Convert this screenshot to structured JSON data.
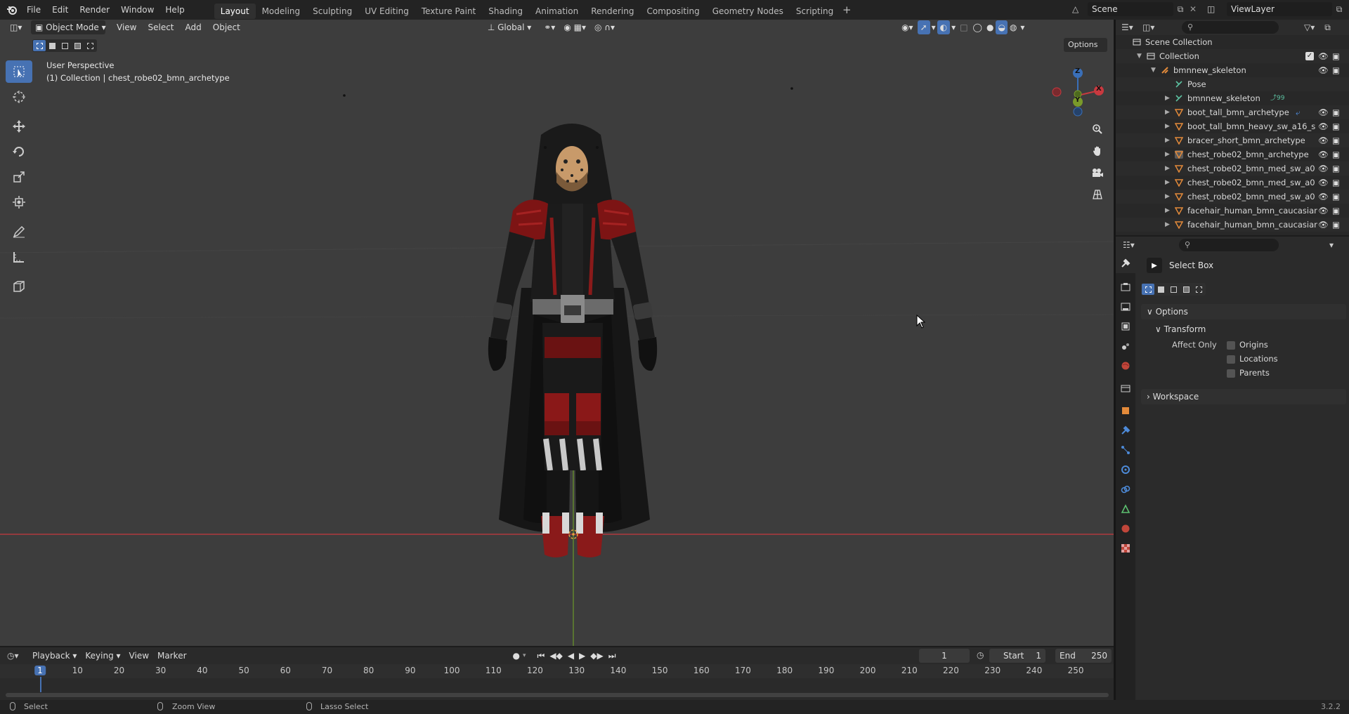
{
  "menu": {
    "file": "File",
    "edit": "Edit",
    "render": "Render",
    "window": "Window",
    "help": "Help"
  },
  "workspaces": [
    "Layout",
    "Modeling",
    "Sculpting",
    "UV Editing",
    "Texture Paint",
    "Shading",
    "Animation",
    "Rendering",
    "Compositing",
    "Geometry Nodes",
    "Scripting"
  ],
  "active_workspace": "Layout",
  "scene": {
    "name": "Scene",
    "view_layer": "ViewLayer"
  },
  "viewport": {
    "mode": "Object Mode",
    "view_menu": "View",
    "select_menu": "Select",
    "add_menu": "Add",
    "object_menu": "Object",
    "orientation": "Global",
    "options": "Options",
    "overlay_title": "User Perspective",
    "overlay_subtitle": "(1) Collection | chest_robe02_bmn_archetype",
    "gizmo": {
      "x": "X",
      "y": "Y",
      "z": "Z"
    }
  },
  "outliner": {
    "rows": [
      {
        "label": "Scene Collection",
        "icon": "scene-collection-icon",
        "indent": 0
      },
      {
        "label": "Collection",
        "icon": "collection-icon",
        "indent": 1,
        "expanded": true
      },
      {
        "label": "bmnnew_skeleton",
        "icon": "armature-icon",
        "indent": 2,
        "expanded": true
      },
      {
        "label": "Pose",
        "icon": "pose-icon",
        "indent": 3
      },
      {
        "label": "bmnnew_skeleton",
        "icon": "armature-data-icon",
        "indent": 3,
        "badge": "99"
      },
      {
        "label": "boot_tall_bmn_archetype",
        "icon": "mesh-icon",
        "indent": 3
      },
      {
        "label": "boot_tall_bmn_heavy_sw_a16_s",
        "icon": "mesh-icon",
        "indent": 3
      },
      {
        "label": "bracer_short_bmn_archetype",
        "icon": "mesh-icon",
        "indent": 3
      },
      {
        "label": "chest_robe02_bmn_archetype",
        "icon": "mesh-icon",
        "indent": 3,
        "selected": true
      },
      {
        "label": "chest_robe02_bmn_med_sw_a0",
        "icon": "mesh-icon",
        "indent": 3
      },
      {
        "label": "chest_robe02_bmn_med_sw_a0",
        "icon": "mesh-icon",
        "indent": 3
      },
      {
        "label": "chest_robe02_bmn_med_sw_a0",
        "icon": "mesh-icon",
        "indent": 3
      },
      {
        "label": "facehair_human_bmn_caucasiar",
        "icon": "mesh-icon",
        "indent": 3
      },
      {
        "label": "facehair_human_bmn_caucasiar",
        "icon": "mesh-icon",
        "indent": 3
      }
    ]
  },
  "properties": {
    "tool_name": "Select Box",
    "options_label": "Options",
    "transform_label": "Transform",
    "affect_only_label": "Affect Only",
    "affect_options": [
      "Origins",
      "Locations",
      "Parents"
    ],
    "workspace_label": "Workspace"
  },
  "timeline": {
    "playback": "Playback",
    "keying": "Keying",
    "view": "View",
    "marker": "Marker",
    "current_frame": "1",
    "start_label": "Start",
    "start": "1",
    "end_label": "End",
    "end": "250",
    "ticks": [
      "1",
      "10",
      "20",
      "30",
      "40",
      "50",
      "60",
      "70",
      "80",
      "90",
      "100",
      "110",
      "120",
      "130",
      "140",
      "150",
      "160",
      "170",
      "180",
      "190",
      "200",
      "210",
      "220",
      "230",
      "240",
      "250"
    ]
  },
  "statusbar": {
    "select": "Select",
    "zoom_view": "Zoom View",
    "lasso_select": "Lasso Select",
    "version": "3.2.2"
  },
  "colors": {
    "accent": "#4772b3",
    "viewport_bg": "#3d3d3d",
    "x_axis": "#c8393f",
    "y_axis": "#6a9a2a",
    "mesh_orange": "#e38a3a"
  }
}
